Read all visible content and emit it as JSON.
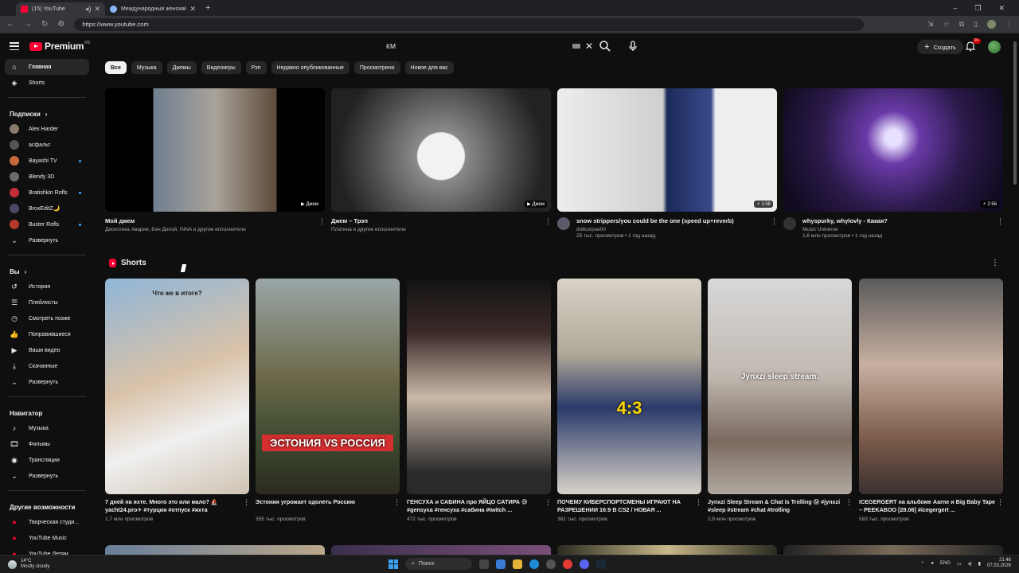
{
  "browser": {
    "tabs": [
      {
        "title": "(15) YouTube",
        "active": true
      },
      {
        "title": "Международный женский де...",
        "active": false
      }
    ],
    "new_tab": "+",
    "url": "https://www.youtube.com"
  },
  "header": {
    "logo_text": "Premium",
    "logo_sup": "RS",
    "search_value": "КМ",
    "create_label": "Создать",
    "notifications_badge": "9+"
  },
  "sidebar": {
    "main": [
      {
        "label": "Главная",
        "icon": "home-icon",
        "active": true
      },
      {
        "label": "Shorts",
        "icon": "shorts-icon",
        "active": false
      }
    ],
    "subscriptions_title": "Подписки",
    "subscriptions": [
      {
        "label": "Alex Harder",
        "color": "#8a7b6b",
        "dot": false
      },
      {
        "label": "асфальт",
        "color": "#555555",
        "dot": false
      },
      {
        "label": "Bayashi TV",
        "color": "#c56a3a",
        "dot": true
      },
      {
        "label": "Blendy 3D",
        "color": "#6b6b6b",
        "dot": false
      },
      {
        "label": "Bratishkin Rofls",
        "color": "#c22f3a",
        "dot": true
      },
      {
        "label": "BroxEditZ🌙",
        "color": "#4a4a66",
        "dot": false
      },
      {
        "label": "Buster Rofls",
        "color": "#b33a2a",
        "dot": true
      }
    ],
    "subs_expand": "Развернуть",
    "you_title": "Вы",
    "you_items": [
      {
        "label": "История",
        "icon": "history-icon"
      },
      {
        "label": "Плейлисты",
        "icon": "playlists-icon"
      },
      {
        "label": "Смотреть позже",
        "icon": "watch-later-icon"
      },
      {
        "label": "Понравившиеся",
        "icon": "like-icon"
      },
      {
        "label": "Ваши видео",
        "icon": "your-videos-icon"
      },
      {
        "label": "Скачанные",
        "icon": "download-icon"
      }
    ],
    "you_expand": "Развернуть",
    "navigator_title": "Навигатор",
    "navigator_items": [
      {
        "label": "Музыка",
        "icon": "music-icon"
      },
      {
        "label": "Фильмы",
        "icon": "film-icon"
      },
      {
        "label": "Трансляции",
        "icon": "live-icon"
      }
    ],
    "nav_expand": "Развернуть",
    "more_title": "Другие возможности",
    "more_items": [
      {
        "label": "Творческая студи...",
        "icon": "studio-icon"
      },
      {
        "label": "YouTube Music",
        "icon": "yt-music-icon"
      },
      {
        "label": "YouTube Детям",
        "icon": "yt-kids-icon"
      }
    ]
  },
  "chips": [
    "Все",
    "Музыка",
    "Джемы",
    "Видеоигры",
    "Рэп",
    "Недавно опубликованные",
    "Просмотрено",
    "Новое для вас"
  ],
  "videos": [
    {
      "title": "Мой джем",
      "sub": "Дискотека Авария, Бен Делэй, INNA и другие исполнители",
      "meta": "",
      "badge": "▶ Джем",
      "has_avatar": false
    },
    {
      "title": "Джем – Трэп",
      "sub": "Платина и другие исполнители",
      "meta": "",
      "badge": "▶ Джем",
      "has_avatar": false
    },
    {
      "title": "snow strippers/you could be the one (speed up+reverb)",
      "sub": "dollcorpse00",
      "meta": "25 тыс. просмотров • 1 год назад",
      "badge": "⚡ 1:58",
      "has_avatar": true
    },
    {
      "title": "whyspurky, whylovly - Какая?",
      "sub": "Music Universe",
      "meta": "1,6 млн просмотров • 1 год назад",
      "badge": "⚡ 2:56",
      "has_avatar": true
    }
  ],
  "shorts_title": "Shorts",
  "shorts": [
    {
      "title": "7 дней на яхте. Много это или мало? ⛵ yacht24.pro✈ #турция #отпуск #яхта",
      "views": "1,7 млн просмотров",
      "caption": "Что же в итоге?"
    },
    {
      "title": "Эстония угрожает одолеть Россию",
      "views": "355 тыс. просмотров",
      "caption": "ЭСТОНИЯ VS РОССИЯ"
    },
    {
      "title": "ГЕНСУХА и САБИНА про ЯЙЦО САТИРА 😅 #gensyxa #генсуха #сабина #twitch ...",
      "views": "472 тыс. просмотров",
      "caption": ""
    },
    {
      "title": "ПОЧЕМУ КИБЕРСПОРТСМЕНЫ ИГРАЮТ НА РАЗРЕШЕНИИ 16:9 В CS2 / НОВАЯ ...",
      "views": "381 тыс. просмотров",
      "caption": "4:3"
    },
    {
      "title": "Jynxzi Sleep Stream & Chat is Trolling 😱 #jynxzi #sleep #stream #chat #trolling",
      "views": "2,9 млн просмотров",
      "caption": "Jynxzi sleep stream."
    },
    {
      "title": "ICEGERGERT на альбоме Aarne и Big Baby Tape – PEEKABOO [28.06] #icegergert ...",
      "views": "583 тыс. просмотров",
      "caption": ""
    }
  ],
  "taskbar": {
    "weather_temp": "14°C",
    "weather_desc": "Mostly cloudy",
    "search_label": "Поиск",
    "lang": "ENG",
    "time": "21:46",
    "date": "07.03.2026"
  }
}
